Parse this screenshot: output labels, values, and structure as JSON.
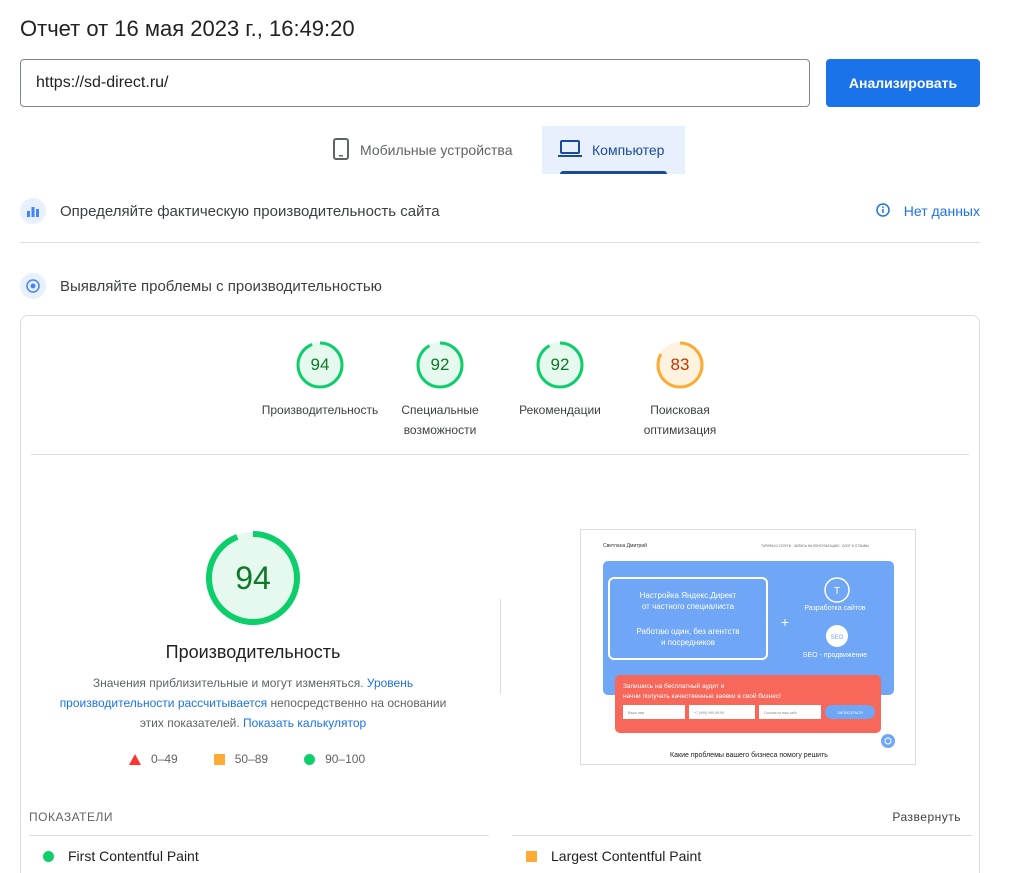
{
  "report_title": "Отчет от 16 мая 2023 г., 16:49:20",
  "url_input": {
    "value": "https://sd-direct.ru/"
  },
  "analyze_label": "Анализировать",
  "tabs": [
    {
      "label": "Мобильные устройства",
      "selected": false,
      "icon": "phone-icon"
    },
    {
      "label": "Компьютер",
      "selected": true,
      "icon": "laptop-icon"
    }
  ],
  "field_data": {
    "title": "Определяйте фактическую производительность сайта",
    "no_data": "Нет данных"
  },
  "lab_data": {
    "title": "Выявляйте проблемы с производительностью"
  },
  "scores": [
    {
      "value": "94",
      "label_lines": [
        "Производительность"
      ],
      "status": "pass"
    },
    {
      "value": "92",
      "label_lines": [
        "Специальные",
        "возможности"
      ],
      "status": "pass"
    },
    {
      "value": "92",
      "label_lines": [
        "Рекомендации"
      ],
      "status": "pass"
    },
    {
      "value": "83",
      "label_lines": [
        "Поисковая",
        "оптимизация"
      ],
      "status": "average"
    }
  ],
  "perf": {
    "score": "94",
    "title": "Производительность",
    "desc_1": "Значения приблизительные и могут изменяться.",
    "desc_link_1": "Уровень производительности рассчитывается",
    "desc_2": "непосредственно на основании этих показателей.",
    "desc_link_2": "Показать калькулятор"
  },
  "legend": [
    {
      "shape": "triangle",
      "color": "#ff3333",
      "label": "0–49"
    },
    {
      "shape": "square",
      "color": "#ffaa33",
      "label": "50–89"
    },
    {
      "shape": "circle",
      "color": "#0cce6b",
      "label": "90–100"
    }
  ],
  "screenshot": {
    "site_name": "Светлана Дмитрий",
    "nav": "ТАРИФЫ И УСЛУГИ · ЗАПИСЬ НА КОНСУЛЬТАЦИЮ · БЛОГ И ОТЗЫВЫ",
    "hero_line_1": "Настройка Яндекс.Директ",
    "hero_line_2": "от частного специалиста",
    "hero_line_3": "Работаю один, без агентств",
    "hero_line_4": "и посредников",
    "service_1": "Разработка сайтов",
    "service_2": "SEO - продвижение",
    "cta_line_1": "Запишись на бесплатный аудит и",
    "cta_line_2": "начни получать качественные заявки в свой бизнес!",
    "field_name": "Ваше имя",
    "field_phone": "+7 (999) 999-99-99",
    "field_site": "Ссылка на ваш сайт",
    "submit": "ЗАПИСАТЬСЯ",
    "footer_text": "Какие проблемы вашего бизнеса помогу решить"
  },
  "metrics": {
    "heading": "ПОКАЗАТЕЛИ",
    "expand": "Развернуть",
    "items": [
      {
        "name": "First Contentful Paint",
        "status": "pass",
        "color": "#0cce6b"
      },
      {
        "name": "Largest Contentful Paint",
        "status": "average",
        "color": "#ffaa33"
      }
    ]
  },
  "colors": {
    "accent": "#1a73e8",
    "pass": "#0cce6b",
    "average": "#ffaa33",
    "fail": "#ff3333"
  }
}
